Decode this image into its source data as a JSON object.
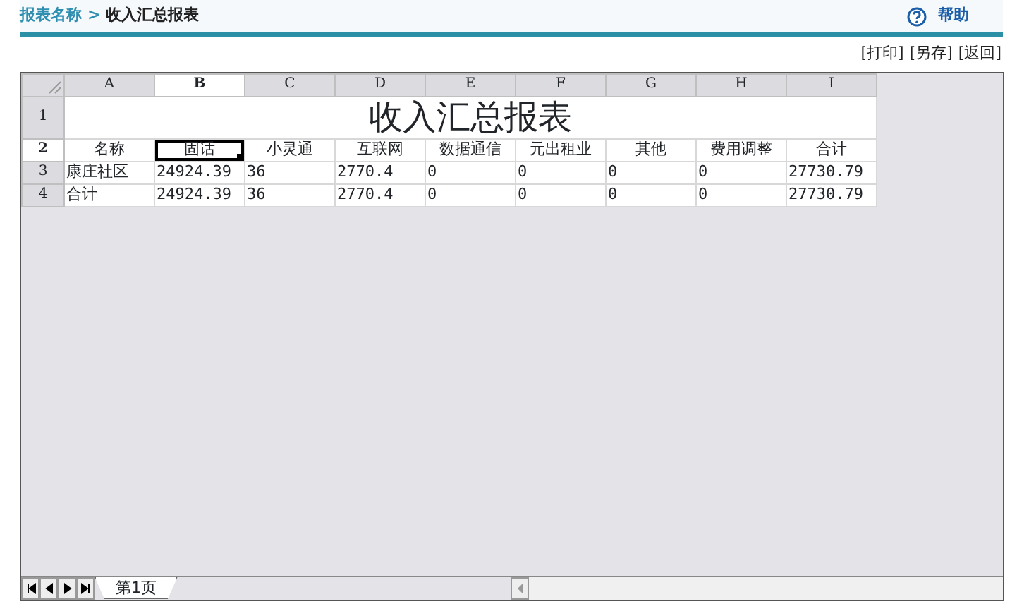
{
  "breadcrumb": {
    "parent": "报表名称",
    "separator": ">",
    "current": "收入汇总报表"
  },
  "help": {
    "label": "帮助"
  },
  "actions": [
    "[打印]",
    "[另存]",
    "[返回]"
  ],
  "sheet": {
    "columns": [
      {
        "label": "A",
        "selected": false
      },
      {
        "label": "B",
        "selected": true
      },
      {
        "label": "C",
        "selected": false
      },
      {
        "label": "D",
        "selected": false
      },
      {
        "label": "E",
        "selected": false
      },
      {
        "label": "F",
        "selected": false
      },
      {
        "label": "G",
        "selected": false
      },
      {
        "label": "H",
        "selected": false
      },
      {
        "label": "I",
        "selected": false
      }
    ],
    "title_row": {
      "header": "1",
      "title": "收入汇总报表"
    },
    "rows": [
      {
        "header": "2",
        "kind": "heading",
        "selected": true,
        "cells": [
          {
            "text": "名称",
            "selected": false
          },
          {
            "text": "固话",
            "selected": true
          },
          {
            "text": "小灵通",
            "selected": false
          },
          {
            "text": "互联网",
            "selected": false
          },
          {
            "text": "数据通信",
            "selected": false
          },
          {
            "text": "元出租业",
            "selected": false
          },
          {
            "text": "其他",
            "selected": false
          },
          {
            "text": "费用调整",
            "selected": false
          },
          {
            "text": "合计",
            "selected": false
          }
        ]
      },
      {
        "header": "3",
        "kind": "data",
        "selected": false,
        "cells": [
          {
            "text": "康庄社区",
            "selected": false
          },
          {
            "text": "24924.39",
            "selected": false
          },
          {
            "text": "36",
            "selected": false
          },
          {
            "text": "2770.4",
            "selected": false
          },
          {
            "text": "0",
            "selected": false
          },
          {
            "text": "0",
            "selected": false
          },
          {
            "text": "0",
            "selected": false
          },
          {
            "text": "0",
            "selected": false
          },
          {
            "text": "27730.79",
            "selected": false
          }
        ]
      },
      {
        "header": "4",
        "kind": "data",
        "selected": false,
        "cells": [
          {
            "text": "合计",
            "selected": false
          },
          {
            "text": "24924.39",
            "selected": false
          },
          {
            "text": "36",
            "selected": false
          },
          {
            "text": "2770.4",
            "selected": false
          },
          {
            "text": "0",
            "selected": false
          },
          {
            "text": "0",
            "selected": false
          },
          {
            "text": "0",
            "selected": false
          },
          {
            "text": "0",
            "selected": false
          },
          {
            "text": "27730.79",
            "selected": false
          }
        ]
      }
    ],
    "tabs": [
      {
        "label": "第1页",
        "selected": true
      }
    ]
  }
}
